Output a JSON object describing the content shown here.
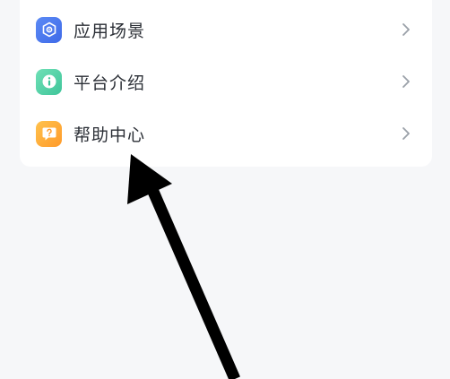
{
  "menu": {
    "items": [
      {
        "label": "应用场景",
        "icon": "app-scene-icon"
      },
      {
        "label": "平台介绍",
        "icon": "info-icon"
      },
      {
        "label": "帮助中心",
        "icon": "help-question-icon"
      }
    ]
  },
  "colors": {
    "page_bg": "#f6f7f9",
    "card_bg": "#ffffff",
    "text": "#2b2f36",
    "chevron": "#9aa0a8",
    "scene_icon": "#4a78ee",
    "intro_icon": "#4fd1a5",
    "help_icon": "#ffad36",
    "annotation_arrow": "#000000"
  }
}
